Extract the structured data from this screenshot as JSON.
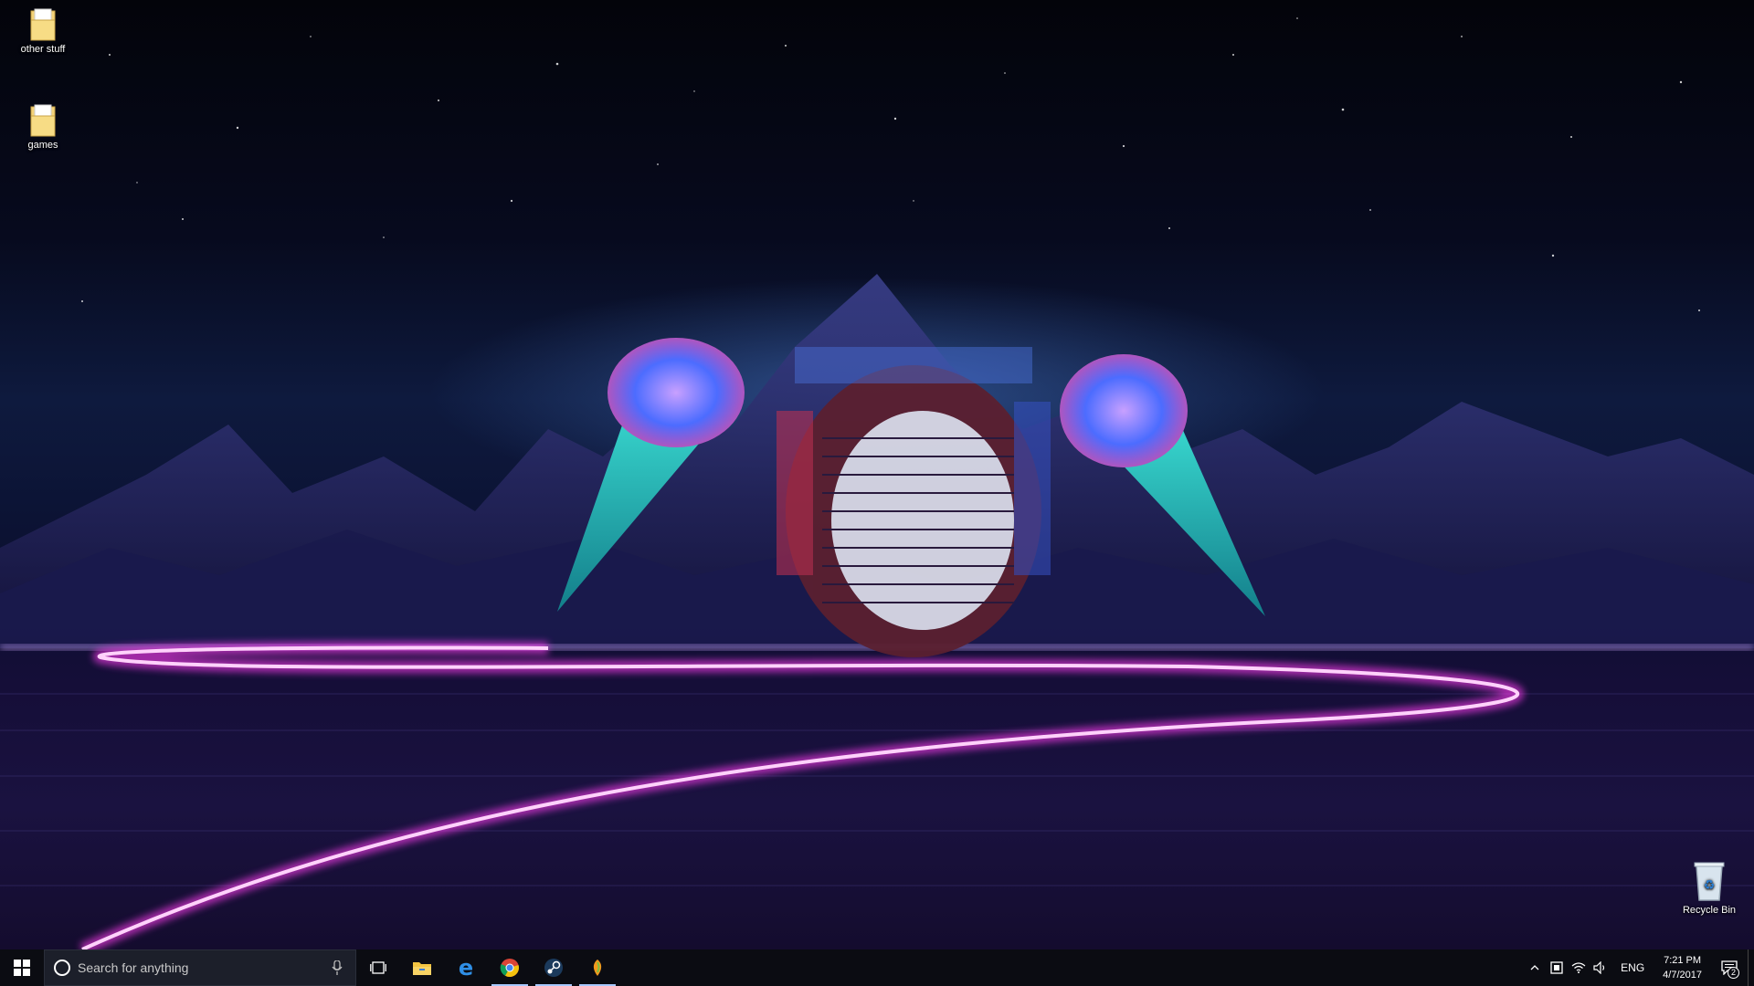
{
  "desktop": {
    "icons": [
      {
        "label": "other stuff",
        "icon": "folder-icon"
      },
      {
        "label": "games",
        "icon": "folder-icon"
      }
    ],
    "recycle_bin": {
      "label": "Recycle Bin",
      "icon": "recycle-bin-icon"
    }
  },
  "taskbar": {
    "search_placeholder": "Search for anything",
    "pinned": [
      {
        "name": "task-view",
        "icon": "task-view-icon"
      },
      {
        "name": "file-explorer",
        "icon": "folder-icon"
      },
      {
        "name": "edge",
        "icon": "edge-icon"
      },
      {
        "name": "chrome",
        "icon": "chrome-icon"
      },
      {
        "name": "steam",
        "icon": "steam-icon"
      },
      {
        "name": "fl-studio",
        "icon": "fl-studio-icon"
      }
    ],
    "tray": {
      "language": "ENG",
      "time": "7:21 PM",
      "date": "4/7/2017",
      "notification_count": "2"
    }
  },
  "colors": {
    "neon_pink": "#ff3cf0",
    "neon_cyan": "#30d6e0",
    "taskbar": "#0b0c12"
  }
}
